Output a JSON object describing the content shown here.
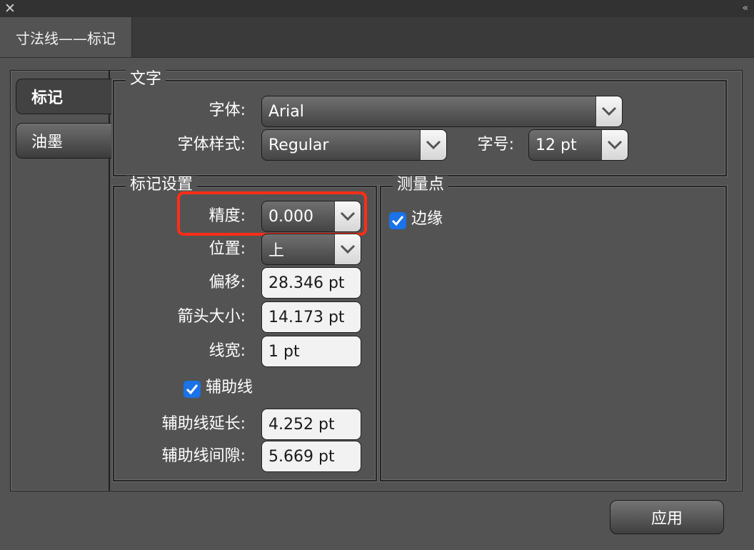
{
  "window": {
    "close_icon": "✕",
    "collapse_icon": "‹‹",
    "panel_tab": "寸法线——标记"
  },
  "side_tabs": [
    {
      "label": "标记",
      "active": true
    },
    {
      "label": "油墨",
      "active": false
    }
  ],
  "text_group": {
    "title": "文字",
    "font_label": "字体:",
    "font_value": "Arial",
    "style_label": "字体样式:",
    "style_value": "Regular",
    "size_label": "字号:",
    "size_value": "12 pt"
  },
  "marker_group": {
    "title": "标记设置",
    "precision_label": "精度:",
    "precision_value": "0.000",
    "position_label": "位置:",
    "position_value": "上",
    "offset_label": "偏移:",
    "offset_value": "28.346 pt",
    "arrow_size_label": "箭头大小:",
    "arrow_size_value": "14.173 pt",
    "line_width_label": "线宽:",
    "line_width_value": "1 pt",
    "guide_checkbox_label": "辅助线",
    "guide_checked": true,
    "guide_extend_label": "辅助线延长:",
    "guide_extend_value": "4.252 pt",
    "guide_gap_label": "辅助线间隙:",
    "guide_gap_value": "5.669 pt"
  },
  "measure_group": {
    "title": "测量点",
    "edge_label": "边缘",
    "edge_checked": true
  },
  "apply_label": "应用",
  "colors": {
    "highlight": "#ff2e17",
    "checkbox": "#1a73e8",
    "panel_bg": "#535353"
  }
}
